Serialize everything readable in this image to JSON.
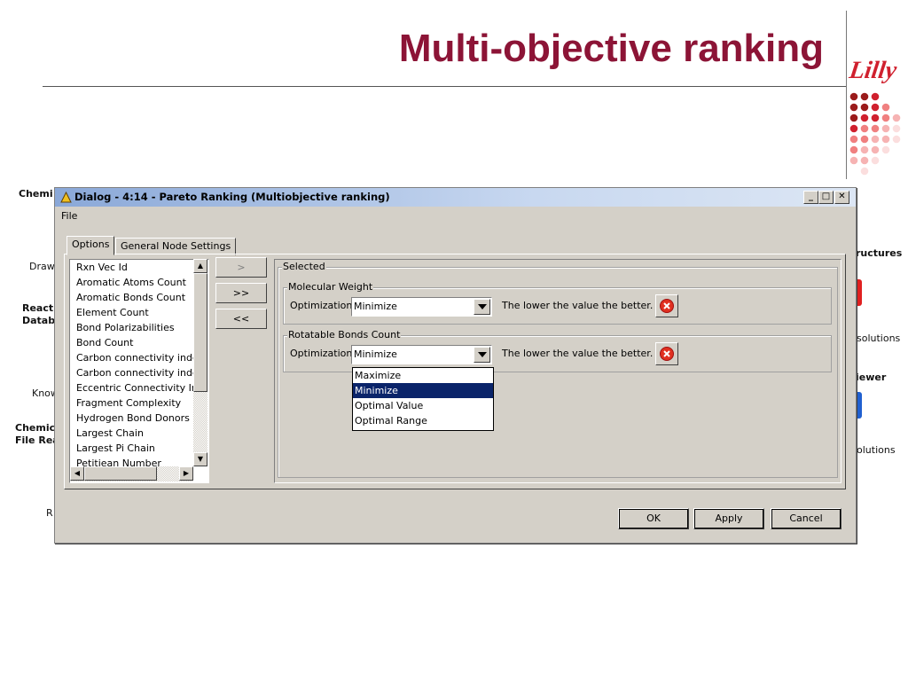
{
  "slide": {
    "title": "Multi-objective ranking",
    "logo": "Lilly",
    "logo_dot_colors": [
      "#9b1b1b",
      "#d0202e",
      "#f08080",
      "#f6b3b3",
      "#fbdede"
    ]
  },
  "background_labels": {
    "chemi_top": "Chemi",
    "draw": "Draw",
    "react": "React",
    "datab": "Datab",
    "know": "Know",
    "chemic": "Chemic",
    "file_rea": "File Rea",
    "r": "R",
    "ructures": "ructures",
    "solutions_1": "solutions",
    "iewer": "iewer",
    "olutions_2": "olutions"
  },
  "dialog": {
    "title": "Dialog - 4:14 - Pareto Ranking (Multiobjective ranking)",
    "window_buttons": {
      "minimize": "_",
      "maximize": "□",
      "close": "✕"
    },
    "menu": {
      "file": "File"
    },
    "tabs": [
      {
        "label": "Options",
        "active": true
      },
      {
        "label": "General Node Settings",
        "active": false
      }
    ],
    "available_columns": [
      "Rxn Vec Id",
      "Aromatic Atoms Count",
      "Aromatic Bonds Count",
      "Element Count",
      "Bond Polarizabilities",
      "Bond Count",
      "Carbon connectivity index",
      "Carbon connectivity index",
      "Eccentric Connectivity Inc",
      "Fragment Complexity",
      "Hydrogen Bond Donors",
      "Largest Chain",
      "Largest Pi Chain",
      "Petitjean Number"
    ],
    "transfer_buttons": {
      "add": ">",
      "add_all": ">>",
      "remove_all": "<<"
    },
    "selected": {
      "label": "Selected",
      "objectives": [
        {
          "name": "Molecular Weight",
          "opt_label": "Optimization",
          "value": "Minimize",
          "hint": "The lower the value the better."
        },
        {
          "name": "Rotatable Bonds Count",
          "opt_label": "Optimization",
          "value": "Minimize",
          "hint": "The lower the value the better."
        }
      ]
    },
    "dropdown_options": [
      "Maximize",
      "Minimize",
      "Optimal Value",
      "Optimal Range"
    ],
    "dropdown_selected_index": 1,
    "footer": {
      "ok": "OK",
      "apply": "Apply",
      "cancel": "Cancel"
    }
  }
}
